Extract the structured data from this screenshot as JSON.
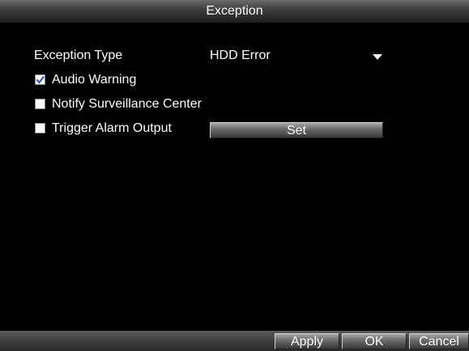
{
  "window": {
    "title": "Exception"
  },
  "form": {
    "exception_type_label": "Exception Type",
    "exception_type_value": "HDD Error",
    "dropdown_icon": "chevron-down-icon",
    "audio_warning": {
      "label": "Audio Warning",
      "checked": true
    },
    "notify_center": {
      "label": "Notify Surveillance Center",
      "checked": false
    },
    "trigger_alarm": {
      "label": "Trigger Alarm Output",
      "checked": false
    },
    "set_label": "Set"
  },
  "footer": {
    "apply_label": "Apply",
    "ok_label": "OK",
    "cancel_label": "Cancel"
  },
  "colors": {
    "check_mark": "#2a5fd6",
    "background": "#000000"
  }
}
